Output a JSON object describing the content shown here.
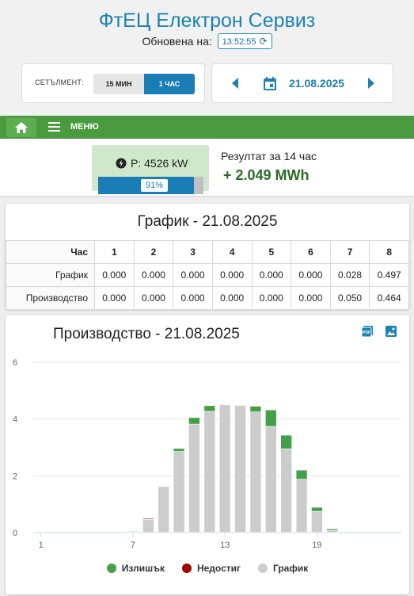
{
  "header": {
    "title": "ФтЕЦ Електрон Сервиз",
    "updated_label": "Обновена на:",
    "updated_time": "13:52:55"
  },
  "settlement": {
    "label": "СЕТЪЛМЕНТ:",
    "option_15": "15 МИН",
    "option_60": "1 ЧАС",
    "selected": "1 ЧАС"
  },
  "date_picker": {
    "date": "21.08.2025",
    "icon": "calendar-icon"
  },
  "nav": {
    "home_icon": "home-icon",
    "menu_icon": "hamburger-icon",
    "menu_label": "МЕНЮ"
  },
  "status": {
    "power_text": "P: 4526 kW",
    "capacity_fraction": 0.91,
    "capacity_label": "91%",
    "result_label": "Резултат за 14 час",
    "result_value": "+ 2.049 MWh"
  },
  "schedule": {
    "title": "График - 21.08.2025",
    "col_header": "Час",
    "hours": [
      "1",
      "2",
      "3",
      "4",
      "5",
      "6",
      "7",
      "8"
    ],
    "rows": [
      {
        "label": "График",
        "values": [
          "0.000",
          "0.000",
          "0.000",
          "0.000",
          "0.000",
          "0.000",
          "0.028",
          "0.497"
        ]
      },
      {
        "label": "Производство",
        "values": [
          "0.000",
          "0.000",
          "0.000",
          "0.000",
          "0.000",
          "0.000",
          "0.050",
          "0.464"
        ]
      }
    ]
  },
  "chart_card": {
    "title": "Производство - 21.08.2025",
    "pdf_icon": "pdf-export-icon",
    "image_icon": "image-export-icon"
  },
  "chart_data": {
    "type": "bar",
    "stacked": true,
    "title": "Производство - 21.08.2025",
    "xlabel": "",
    "ylabel": "",
    "ylim": [
      0,
      6
    ],
    "yticks": [
      0,
      2,
      4,
      6
    ],
    "xticks": [
      1,
      7,
      13,
      19
    ],
    "categories": [
      1,
      2,
      3,
      4,
      5,
      6,
      7,
      8,
      9,
      10,
      11,
      12,
      13,
      14,
      15,
      16,
      17,
      18,
      19,
      20,
      21,
      22,
      23,
      24
    ],
    "series": [
      {
        "name": "График",
        "color": "#cccccc",
        "values": [
          0,
          0,
          0,
          0,
          0,
          0,
          0.028,
          0.464,
          1.62,
          2.86,
          3.82,
          4.27,
          4.5,
          4.48,
          4.25,
          3.74,
          2.95,
          1.88,
          0.75,
          0.08,
          0,
          0,
          0,
          0
        ]
      },
      {
        "name": "Излишък",
        "color": "#43a047",
        "values": [
          0,
          0,
          0,
          0,
          0,
          0,
          0.022,
          0,
          0,
          0.1,
          0.23,
          0.2,
          0,
          0,
          0.2,
          0.58,
          0.48,
          0.32,
          0.14,
          0.05,
          0,
          0,
          0,
          0
        ]
      },
      {
        "name": "Недостиг",
        "color": "#a00000",
        "values": [
          0,
          0,
          0,
          0,
          0,
          0,
          0,
          0.033,
          0,
          0,
          0,
          0,
          0,
          0,
          0,
          0,
          0,
          0,
          0,
          0,
          0,
          0,
          0,
          0
        ]
      }
    ],
    "grid": true,
    "legend": "bottom-center"
  },
  "legend": {
    "surplus": "Излишък",
    "deficit": "Недостиг",
    "schedule": "График"
  }
}
